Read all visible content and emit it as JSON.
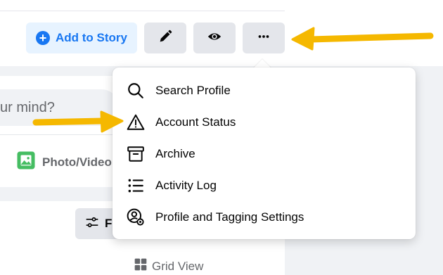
{
  "header": {
    "add_story_label": "Add to Story",
    "icons": {
      "edit": "pencil-icon",
      "view": "eye-icon",
      "more": "more-dots-icon"
    }
  },
  "composer": {
    "placeholder_fragment": "ur mind?",
    "photo_label": "Photo/Video"
  },
  "posts_bar": {
    "filters_fragment": "Fi",
    "grid_view_label": "Grid View"
  },
  "menu": {
    "items": [
      {
        "label": "Search Profile",
        "icon": "search-icon"
      },
      {
        "label": "Account Status",
        "icon": "warning-icon"
      },
      {
        "label": "Archive",
        "icon": "archive-icon"
      },
      {
        "label": "Activity Log",
        "icon": "list-icon"
      },
      {
        "label": "Profile and Tagging Settings",
        "icon": "profile-settings-icon"
      }
    ]
  },
  "colors": {
    "accent": "#1877f2",
    "annotation_arrow": "#f5b800",
    "photo_icon": "#45bd62"
  }
}
